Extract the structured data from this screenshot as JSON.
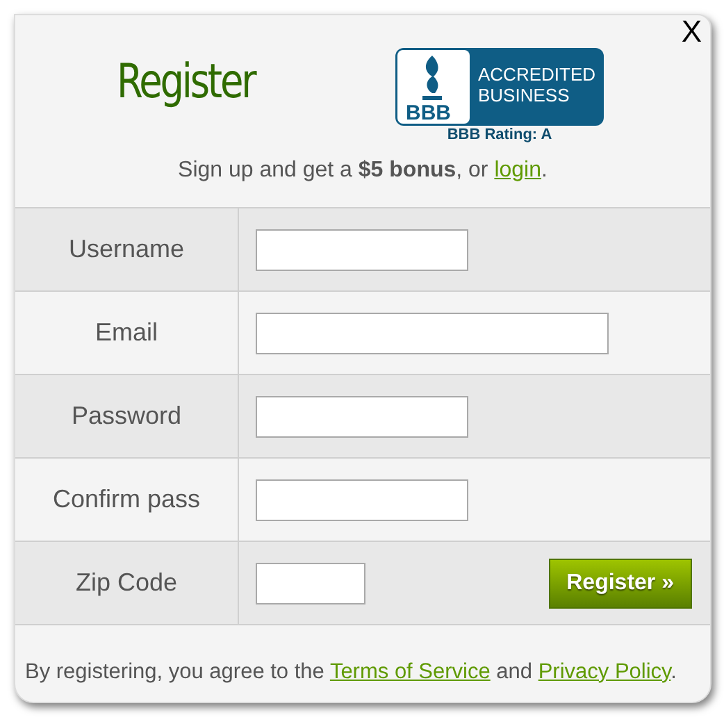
{
  "dialog": {
    "close": "X",
    "title": "Register",
    "badge": {
      "mark": "BBB",
      "lines": [
        "ACCREDITED",
        "BUSINESS"
      ],
      "rating": "BBB Rating: A"
    },
    "intro": {
      "text": "Sign up and get a **$5 bonus**, or ",
      "link": "login",
      "after": "."
    },
    "fields": [
      {
        "label": "Username",
        "kind": "text"
      },
      {
        "label": "Email",
        "kind": "email"
      },
      {
        "label": "Password",
        "kind": "password"
      },
      {
        "label": "Confirm pass",
        "kind": "password"
      },
      {
        "label": "Zip Code",
        "kind": "zip"
      }
    ],
    "submit": "Register »",
    "footer": [
      {
        "kind": "text",
        "text": "By registering, you agree to the "
      },
      {
        "kind": "link",
        "text": "Terms of Service"
      },
      {
        "kind": "text",
        "text": " and "
      },
      {
        "kind": "link",
        "text": "Privacy Policy"
      },
      {
        "kind": "text",
        "text": "."
      }
    ]
  }
}
